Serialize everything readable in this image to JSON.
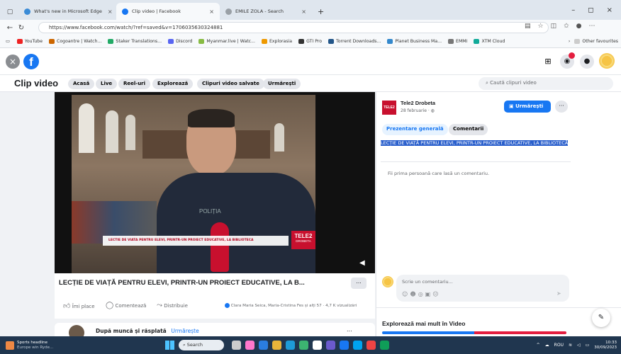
{
  "browser": {
    "tabs": [
      {
        "title": "What's new in Microsoft Edge",
        "color": "#3a8bd6"
      },
      {
        "title": "Clip video | Facebook",
        "color": "#1877f2"
      },
      {
        "title": "EMILE ZOLA - Search",
        "color": "#9aa0a6"
      }
    ],
    "new_tab": "+",
    "url": "https://www.facebook.com/watch/?ref=saved&v=1706035630324881",
    "bookmarks": [
      "YouTube",
      "Cogoantre | Watch...",
      "Staker Translations...",
      "Discord",
      "Myanmar.live | Watc...",
      "Explorasia",
      "GTI Pro",
      "Torrent Downloads...",
      "Planet Business Ma...",
      "EMMI",
      "XTM Cloud"
    ],
    "bookmarks_more": "Other favourites"
  },
  "fb": {
    "section_title": "Clip video",
    "nav": [
      "Acasă",
      "Live",
      "Reel-uri",
      "Explorează",
      "Clipuri video salvate",
      "Urmărești"
    ],
    "search_placeholder": "Caută clipuri video",
    "video": {
      "title": "LECȚIE DE VIAȚĂ PENTRU ELEVI, PRINTR-UN PROIECT EDUCATIVE, LA B...",
      "caption_lower_third": "LECTIE DE VIATA PENTRU ELEVI, PRINTR-UN PROIECT EDUCATIVE, LA BIBLIOTECA",
      "logo_text": "TELE2",
      "logo_sub": "DROBETA",
      "more": "..."
    },
    "actions": {
      "like": "Îmi place",
      "comment": "Comentează",
      "share": "Distribuie",
      "viewers": "Clara Maria Seica, Maria-Cristina Fes și alți 57 · 4,7 K vizualizări"
    },
    "next_post": {
      "title": "După muncă și răsplată",
      "follow": "Urmărește",
      "more": "..."
    },
    "page": {
      "name": "Tele2 Drobeta",
      "date": "28 februarie · ",
      "follow_btn": "Urmărești",
      "more": "···",
      "tab_overview": "Prezentare generală",
      "tab_comments": "Comentarii",
      "description": "LECȚIE DE VIAȚĂ PENTRU ELEVI, PRINTR-UN PROIECT EDUCATIVE, LA BIBLIOTECĂ",
      "first_comment": "Fii prima persoană care lasă un comentariu.",
      "comment_placeholder": "Scrie un comentariu...",
      "explore": "Explorează mai mult în Video"
    }
  },
  "taskbar": {
    "weather_title": "Sports headline",
    "weather_sub": "Europe win Ryde...",
    "search": "Search",
    "lang": "ROU",
    "time": "10:33",
    "date": "30/09/2023"
  },
  "colors": {
    "fb_blue": "#1877f2",
    "selection": "#2a5fcc",
    "taskbar": "#20364f"
  }
}
